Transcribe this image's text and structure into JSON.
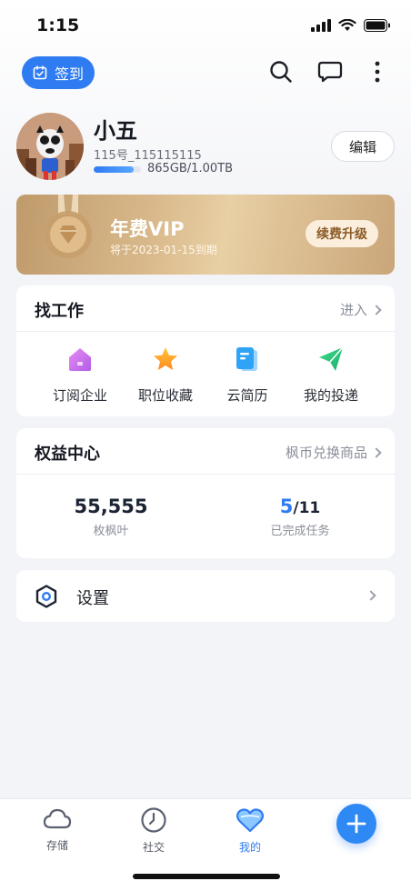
{
  "status_bar": {
    "time": "1:15"
  },
  "header": {
    "checkin_label": "签到"
  },
  "profile": {
    "name": "小五",
    "id": "115号_115115115",
    "storage_text": "865GB/1.00TB",
    "storage_fraction": 0.845,
    "edit_label": "编辑"
  },
  "vip": {
    "title": "年费VIP",
    "subtitle": "将于2023-01-15到期",
    "button_label": "续费升级"
  },
  "jobs": {
    "title": "找工作",
    "link": "进入",
    "items": [
      {
        "label": "订阅企业",
        "icon": "home-icon"
      },
      {
        "label": "职位收藏",
        "icon": "star-icon"
      },
      {
        "label": "云简历",
        "icon": "document-icon"
      },
      {
        "label": "我的投递",
        "icon": "send-icon"
      }
    ]
  },
  "benefits": {
    "title": "权益中心",
    "link": "枫币兑换商品",
    "leaves_value": "55,555",
    "leaves_label": "枚枫叶",
    "tasks_done": "5",
    "tasks_total": "/11",
    "tasks_label": "已完成任务"
  },
  "settings": {
    "label": "设置"
  },
  "tab_bar": {
    "tabs": [
      {
        "label": "存储",
        "icon": "cloud-icon"
      },
      {
        "label": "社交",
        "icon": "clock-icon"
      },
      {
        "label": "我的",
        "icon": "heart-icon",
        "active": true
      }
    ]
  },
  "colors": {
    "accent": "#2f7bf2",
    "vip_gold": "#d8b88a",
    "background": "#f3f4f7"
  }
}
